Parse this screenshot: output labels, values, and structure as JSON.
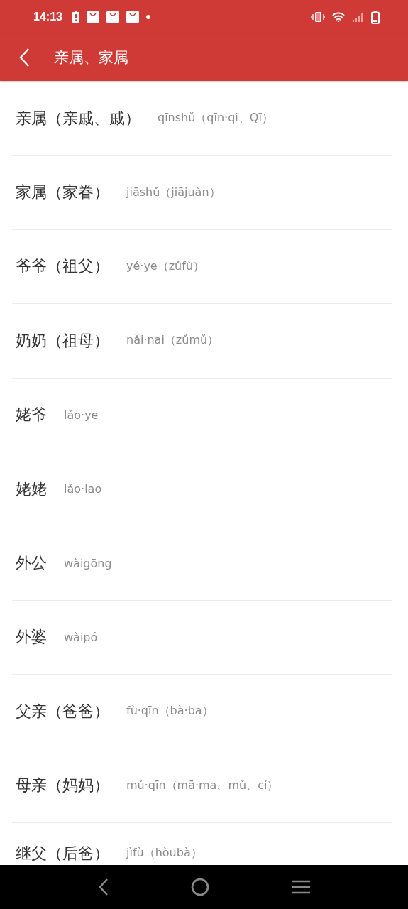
{
  "status_bar": {
    "time": "14:13"
  },
  "header": {
    "title": "亲属、家属"
  },
  "terms": [
    {
      "word": "亲属（亲戚、戚）",
      "pinyin": "qīnshǔ（qīn·qi、Qī）"
    },
    {
      "word": "家属（家眷）",
      "pinyin": "jiāshǔ（jiājuàn）"
    },
    {
      "word": "爷爷（祖父）",
      "pinyin": "yé·ye（zǔfù）"
    },
    {
      "word": "奶奶（祖母）",
      "pinyin": "nǎi·nai（zǔmǔ）"
    },
    {
      "word": "姥爷",
      "pinyin": "lǎo·ye"
    },
    {
      "word": "姥姥",
      "pinyin": "lǎo·lao"
    },
    {
      "word": "外公",
      "pinyin": "wàigōng"
    },
    {
      "word": "外婆",
      "pinyin": "wàipó"
    },
    {
      "word": "父亲（爸爸）",
      "pinyin": "fù·qīn（bà·ba）"
    },
    {
      "word": "母亲（妈妈）",
      "pinyin": "mǔ·qīn（mā·ma、mǔ、cí）"
    },
    {
      "word": "继父（后爸）",
      "pinyin": "jìfù（hòubà）"
    }
  ]
}
